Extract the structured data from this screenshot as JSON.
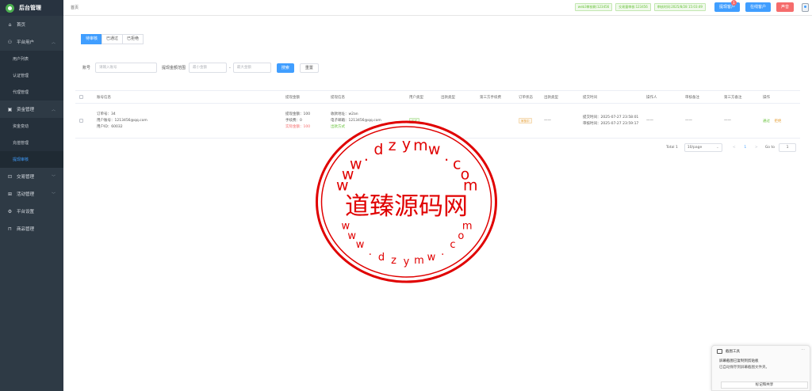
{
  "sidebar": {
    "title": "后台管理",
    "items": [
      {
        "label": "首页",
        "icon": "home-icon",
        "glyph": "⌂"
      },
      {
        "label": "平台用户",
        "icon": "user-icon",
        "glyph": "⚇"
      },
      {
        "label": "资金管理",
        "icon": "money-icon",
        "glyph": "▣"
      },
      {
        "label": "交易管理",
        "icon": "bag-icon",
        "glyph": "⊡"
      },
      {
        "label": "活动管理",
        "icon": "gift-icon",
        "glyph": "⊞"
      },
      {
        "label": "平台设置",
        "icon": "gear-icon",
        "glyph": "⚙"
      },
      {
        "label": "商品管理",
        "icon": "goods-icon",
        "glyph": "⊓"
      }
    ],
    "user_subs": [
      "用户列表",
      "认证管理",
      "代理管理"
    ],
    "fund_subs": [
      "资金变动",
      "充值管理",
      "提现审核"
    ]
  },
  "topbar": {
    "breadcrumb": "首页",
    "tags": [
      "web3审核剩:123456",
      "交易量审核:123456",
      "审核时间:2025/8/28 15:03:49"
    ],
    "withdraw_btn": "提现客户",
    "withdraw_badge": "1",
    "online_btn": "在线客户",
    "sound_btn": "声音"
  },
  "tabs": [
    "待审核",
    "已通过",
    "已拒绝"
  ],
  "filters": {
    "account_label": "账号",
    "account_placeholder": "请输入账号",
    "range_label": "提现金额范围",
    "min_placeholder": "最小金额",
    "dash": "-",
    "max_placeholder": "最大金额",
    "search_btn": "搜索",
    "reset_btn": "重置"
  },
  "table": {
    "headers": [
      "账号信息",
      "提现金额",
      "提现信息",
      "用户类型",
      "出款类型",
      "第三方手续费",
      "订单状态",
      "出款类型",
      "提交时间",
      "操作人",
      "审核备注",
      "第三方备注",
      "操作"
    ],
    "row": {
      "order_no": "订单号：34",
      "account": "用户账号：1213456@qq.com",
      "uid": "用户ID：60032",
      "amount": "提现金额：100",
      "fee": "手续费：0",
      "actual": "实际金额：100",
      "addr": "收款地址：w2an",
      "email": "电子邮箱：1213456@qq.com",
      "method": "出款方式",
      "user_type": "正式",
      "third_fee": "",
      "status": "审核中",
      "pay_type": "——",
      "submit_time": "提交时间：2025-07-27 23:58:01",
      "audit_time": "审核时间：2025-07-27 23:59:17",
      "operator": "——",
      "audit_note": "——",
      "third_note": "——",
      "approve": "通过",
      "reject": "拒绝"
    }
  },
  "pager": {
    "total": "Total 1",
    "size": "10/page",
    "prev": "<",
    "page": "1",
    "next": ">",
    "goto": "Go to",
    "goto_value": "1"
  },
  "watermark": {
    "center": "道臻源码网",
    "ring_top": "www.dzymw.com",
    "ring_bottom": "www.dzymw.com",
    "color": "#e00000"
  },
  "notification": {
    "title": "截图工具",
    "dots": "···",
    "line1": "屏幕截图已复制到剪贴板",
    "line2": "已自动保存到屏幕截图文件夹。",
    "button": "标记和共享"
  }
}
